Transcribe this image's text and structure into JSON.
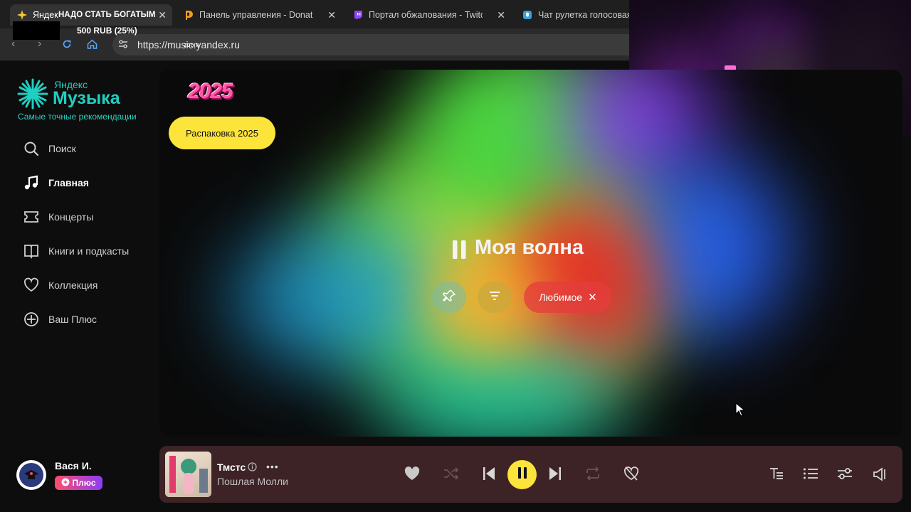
{
  "browser": {
    "tabs": [
      {
        "title": "Яндекс Музыка — собираем музыку для вас",
        "active": true
      },
      {
        "title": "Панель управления - DonationAlerts"
      },
      {
        "title": "Портал обжалования - Twitch"
      },
      {
        "title": "Чат рулетка голосовая"
      }
    ],
    "stream_overlay_text": "НАДО СТАТЬ БОГАТЫМ",
    "donation_goal": "500 RUB (25%)",
    "zoom_label": "zoom",
    "url": "https://music.yandex.ru"
  },
  "sidebar": {
    "logo_small": "Яндекс",
    "logo_big": "Музыка",
    "tagline": "Самые точные рекомендации",
    "items": [
      {
        "label": "Поиск",
        "icon": "search-icon"
      },
      {
        "label": "Главная",
        "icon": "music-note-icon",
        "active": true
      },
      {
        "label": "Концерты",
        "icon": "ticket-icon"
      },
      {
        "label": "Книги и подкасты",
        "icon": "book-icon"
      },
      {
        "label": "Коллекция",
        "icon": "heart-icon"
      },
      {
        "label": "Ваш Плюс",
        "icon": "plus-circle-icon"
      }
    ]
  },
  "main": {
    "badge": "2025",
    "unbox_button": "Распаковка 2025",
    "wave_title": "Моя волна",
    "favorite_chip": "Любимое"
  },
  "user": {
    "name": "Вася И.",
    "plus_label": "Плюс"
  },
  "player": {
    "track_title": "Тмстс",
    "artist": "Пошлая Молли",
    "state": "playing"
  },
  "colors": {
    "accent_yellow": "#fde43a",
    "brand_teal": "#1ed0c2",
    "player_bg": "#3d2326"
  }
}
